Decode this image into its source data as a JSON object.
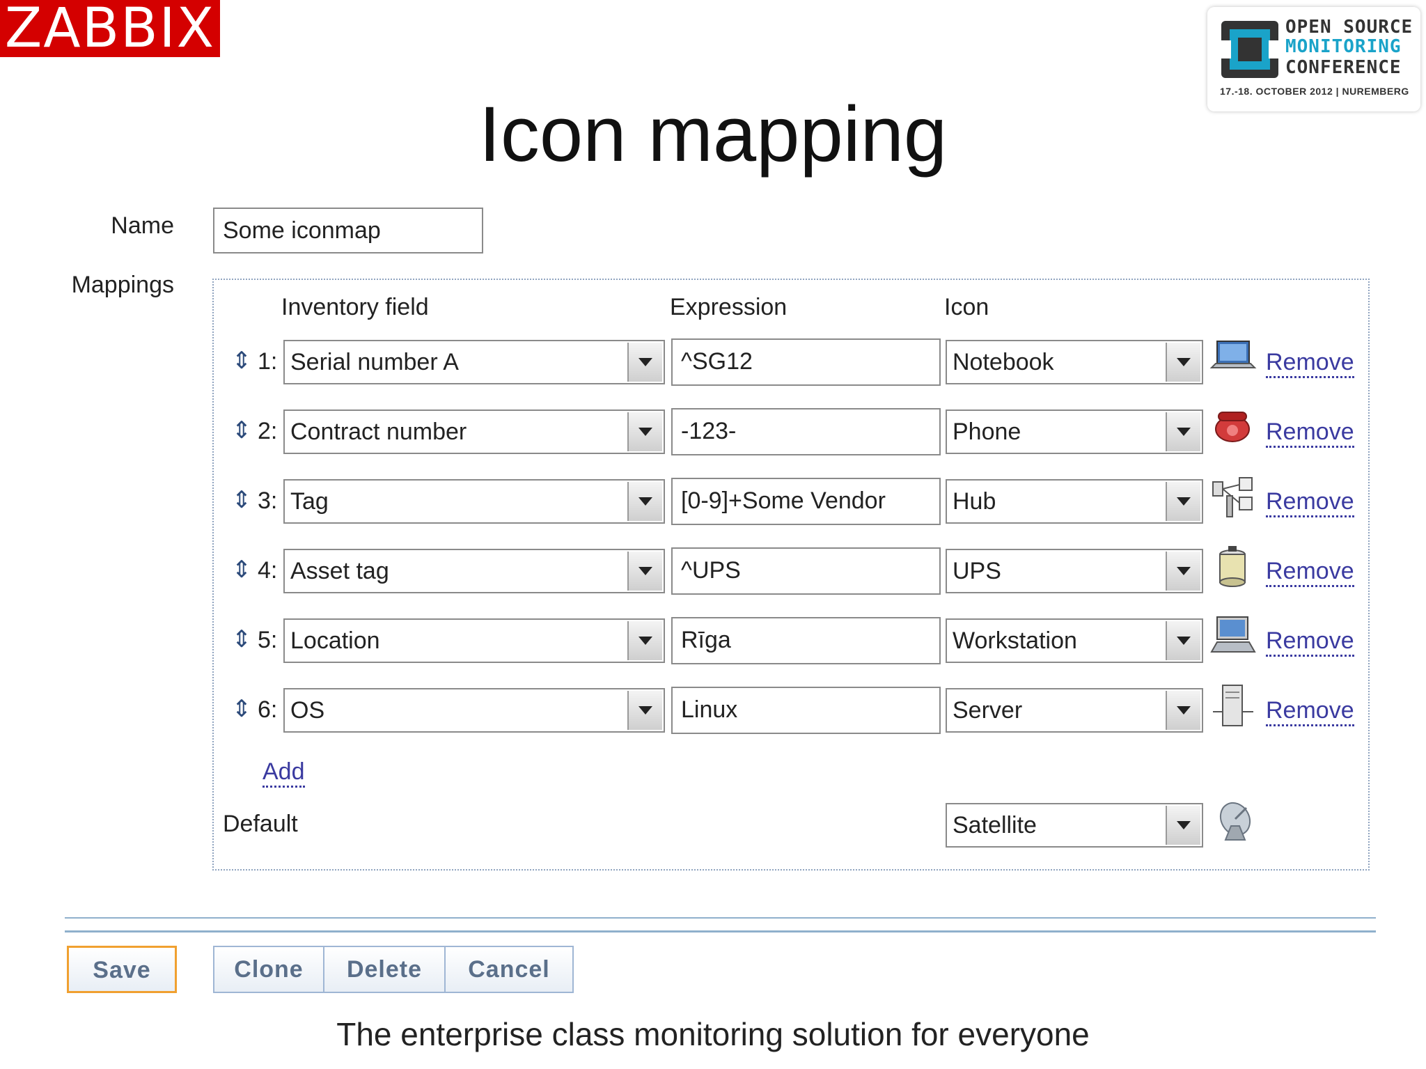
{
  "brand": {
    "logo_text": "ZABBIX",
    "logo_color": "#d40000"
  },
  "badge": {
    "line1": "OPEN SOURCE",
    "line2": "MONITORING",
    "line3": "CONFERENCE",
    "date": "17.-18. OCTOBER 2012  |  NUREMBERG",
    "accent": "#1aa3c9"
  },
  "title": "Icon mapping",
  "form": {
    "name_label": "Name",
    "name_value": "Some iconmap",
    "mappings_label": "Mappings",
    "headers": {
      "inventory": "Inventory field",
      "expression": "Expression",
      "icon": "Icon"
    },
    "rows": [
      {
        "num": "1:",
        "field": "Serial number A",
        "expression": "^SG12",
        "icon": "Notebook",
        "icon_name": "notebook-icon",
        "remove": "Remove"
      },
      {
        "num": "2:",
        "field": "Contract number",
        "expression": "-123-",
        "icon": "Phone",
        "icon_name": "phone-icon",
        "remove": "Remove"
      },
      {
        "num": "3:",
        "field": "Tag",
        "expression": "[0-9]+Some Vendor",
        "icon": "Hub",
        "icon_name": "hub-icon",
        "remove": "Remove"
      },
      {
        "num": "4:",
        "field": "Asset tag",
        "expression": "^UPS",
        "icon": "UPS",
        "icon_name": "ups-icon",
        "remove": "Remove"
      },
      {
        "num": "5:",
        "field": "Location",
        "expression": "Rīga",
        "icon": "Workstation",
        "icon_name": "workstation-icon",
        "remove": "Remove"
      },
      {
        "num": "6:",
        "field": "OS",
        "expression": "Linux",
        "icon": "Server",
        "icon_name": "server-icon",
        "remove": "Remove"
      }
    ],
    "add_label": "Add",
    "default_label": "Default",
    "default_icon": "Satellite"
  },
  "buttons": {
    "save": "Save",
    "clone": "Clone",
    "delete": "Delete",
    "cancel": "Cancel"
  },
  "footer": "The enterprise class monitoring solution for everyone"
}
